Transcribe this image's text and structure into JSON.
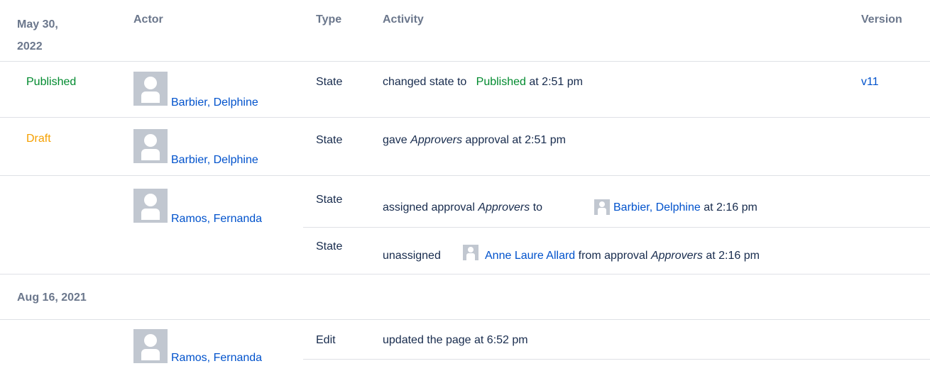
{
  "header": {
    "date_line1": "May 30,",
    "date_line2": "2022",
    "actor": "Actor",
    "type": "Type",
    "activity": "Activity",
    "version": "Version"
  },
  "rows": [
    {
      "state": "Published",
      "actor": "Barbier, Delphine",
      "type": "State",
      "activity_prefix": "changed state to",
      "activity_state": "Published",
      "activity_suffix": "at 2:51 pm",
      "version": "v11"
    },
    {
      "state": "Draft",
      "actor": "Barbier, Delphine",
      "type": "State",
      "activity_prefix": "gave",
      "activity_em": "Approvers",
      "activity_suffix": "approval at 2:51 pm"
    },
    {
      "actor": "Ramos, Fernanda",
      "entries": [
        {
          "type": "State",
          "prefix": "assigned approval",
          "em": "Approvers",
          "mid": "to",
          "user": "Barbier, Delphine",
          "suffix": "at 2:16 pm"
        },
        {
          "type": "State",
          "prefix": "unassigned",
          "user": "Anne Laure Allard",
          "mid": "from approval",
          "em": "Approvers",
          "suffix": "at 2:16 pm"
        }
      ]
    }
  ],
  "group2": {
    "date": "Aug 16, 2021",
    "actor": "Ramos, Fernanda",
    "type": "Edit",
    "activity": "updated the page at 6:52 pm"
  }
}
